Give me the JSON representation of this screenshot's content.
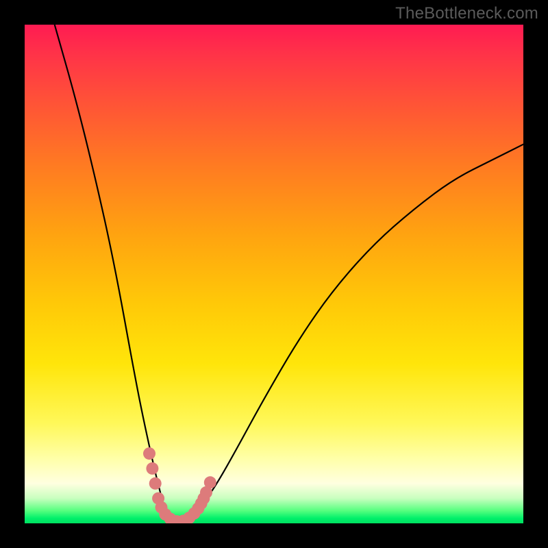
{
  "watermark": "TheBottleneck.com",
  "chart_data": {
    "type": "line",
    "title": "",
    "xlabel": "",
    "ylabel": "",
    "xlim": [
      0,
      100
    ],
    "ylim": [
      0,
      100
    ],
    "grid": false,
    "legend": false,
    "series": [
      {
        "name": "bottleneck-curve",
        "x": [
          6,
          10,
          14,
          18,
          22,
          24,
          26,
          27,
          28,
          29,
          30,
          31,
          33,
          35,
          38,
          42,
          48,
          55,
          62,
          70,
          78,
          86,
          94,
          100
        ],
        "values": [
          100,
          86,
          70,
          52,
          30,
          20,
          11,
          7,
          3,
          1,
          0,
          0,
          1,
          3,
          7,
          14,
          25,
          37,
          47,
          56,
          63,
          69,
          73,
          76
        ]
      }
    ],
    "markers": {
      "name": "highlighted-points",
      "color": "#dd7b7b",
      "points": [
        {
          "x": 25.0,
          "y": 14
        },
        {
          "x": 25.6,
          "y": 11
        },
        {
          "x": 26.2,
          "y": 8
        },
        {
          "x": 26.8,
          "y": 5
        },
        {
          "x": 27.4,
          "y": 3.2
        },
        {
          "x": 28.2,
          "y": 1.8
        },
        {
          "x": 29.2,
          "y": 0.9
        },
        {
          "x": 30.5,
          "y": 0.4
        },
        {
          "x": 31.8,
          "y": 0.5
        },
        {
          "x": 33.0,
          "y": 1.1
        },
        {
          "x": 34.0,
          "y": 2.0
        },
        {
          "x": 34.8,
          "y": 3.0
        },
        {
          "x": 35.4,
          "y": 4.0
        },
        {
          "x": 35.9,
          "y": 5.0
        },
        {
          "x": 36.4,
          "y": 6.2
        },
        {
          "x": 37.2,
          "y": 8.2
        }
      ]
    },
    "background_gradient": {
      "top": "#ff1b52",
      "mid_upper": "#ffa310",
      "mid": "#ffe50a",
      "mid_lower": "#ffffe0",
      "bottom": "#00e060"
    }
  }
}
